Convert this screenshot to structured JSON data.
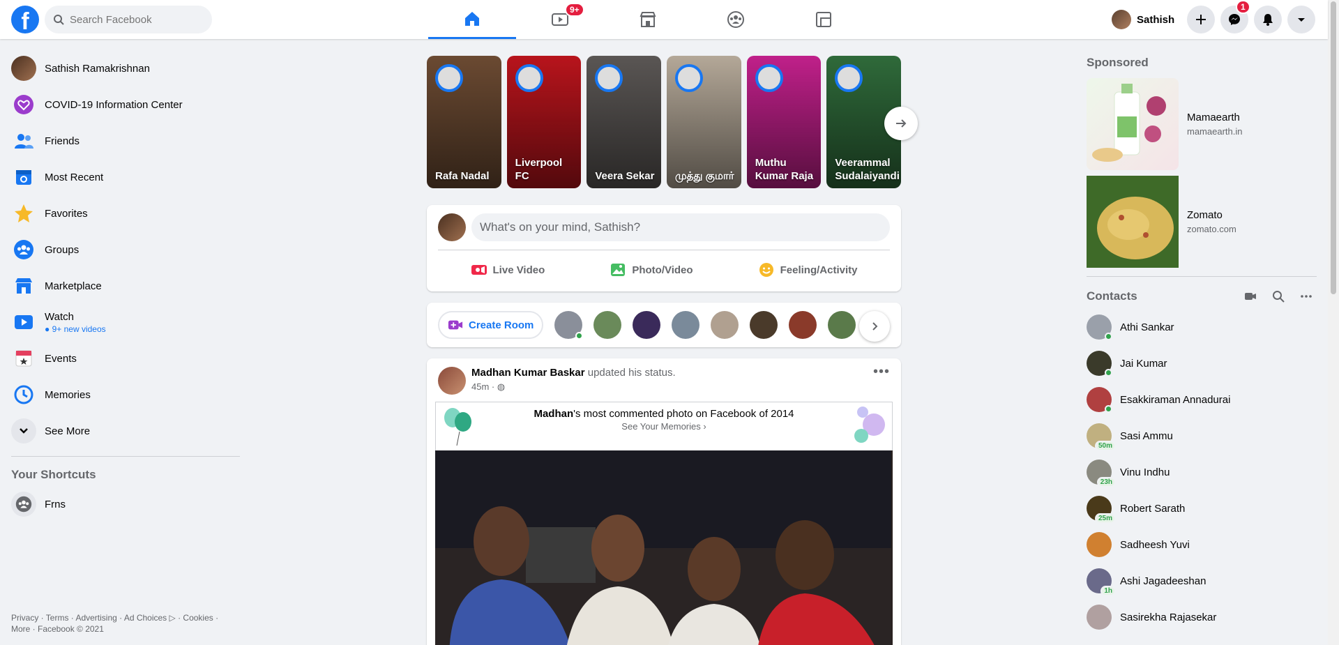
{
  "header": {
    "logo": "f",
    "search_placeholder": "Search Facebook",
    "watch_badge": "9+",
    "profile_name": "Sathish",
    "messenger_badge": "1"
  },
  "sidebar": {
    "items": [
      {
        "label": "Sathish Ramakrishnan",
        "icon": "avatar"
      },
      {
        "label": "COVID-19 Information Center",
        "icon": "heart-icon"
      },
      {
        "label": "Friends",
        "icon": "friends-icon"
      },
      {
        "label": "Most Recent",
        "icon": "calendar-icon"
      },
      {
        "label": "Favorites",
        "icon": "star-icon"
      },
      {
        "label": "Groups",
        "icon": "groups-icon"
      },
      {
        "label": "Marketplace",
        "icon": "store-icon"
      },
      {
        "label": "Watch",
        "sub": "9+ new videos",
        "icon": "watch-icon"
      },
      {
        "label": "Events",
        "icon": "events-icon"
      },
      {
        "label": "Memories",
        "icon": "clock-icon"
      },
      {
        "label": "See More",
        "icon": "chevron-down-icon"
      }
    ],
    "shortcuts_title": "Your Shortcuts",
    "shortcuts": [
      {
        "label": "Frns"
      }
    ],
    "footer_line1": "Privacy · Terms · Advertising · Ad Choices ▷ · Cookies ·",
    "footer_line2": "More · Facebook © 2021"
  },
  "stories": [
    {
      "name": "Rafa Nadal",
      "bg": "#6b4a32"
    },
    {
      "name": "Liverpool FC",
      "bg": "#b8141c"
    },
    {
      "name": "Veera Sekar",
      "bg": "#5a5654"
    },
    {
      "name": "முத்து குமார்",
      "bg": "#b4a898"
    },
    {
      "name": "Muthu Kumar Raja",
      "bg": "#c0208a"
    },
    {
      "name": "Veerammal Sudalaiyandi",
      "bg": "#2f6a3a"
    }
  ],
  "composer": {
    "placeholder": "What's on your mind, Sathish?",
    "live": "Live Video",
    "photo": "Photo/Video",
    "feeling": "Feeling/Activity"
  },
  "rooms": {
    "create": "Create Room",
    "avatar_colors": [
      "#8a8f9a",
      "#6a8a5a",
      "#3a2a5a",
      "#7a8a9a",
      "#b0a090",
      "#4a3a2a",
      "#8a3a2a",
      "#5a7a4a",
      "#6a5a3a"
    ]
  },
  "post": {
    "author": "Madhan Kumar Baskar",
    "action": "updated his status.",
    "time": "45m ·",
    "more": "•••",
    "memory_name": "Madhan",
    "memory_text": "'s most commented photo on Facebook of 2014",
    "memory_link": "See Your Memories ›"
  },
  "right": {
    "sponsored_title": "Sponsored",
    "ads": [
      {
        "name": "Mamaearth",
        "url": "mamaearth.in",
        "color": "#e9f5e6"
      },
      {
        "name": "Zomato",
        "url": "zomato.com",
        "color": "#4a6a30"
      }
    ],
    "contacts_title": "Contacts",
    "contacts": [
      {
        "name": "Athi Sankar",
        "status": "online",
        "color": "#9aa0aa"
      },
      {
        "name": "Jai Kumar",
        "status": "online",
        "color": "#3a3a2a"
      },
      {
        "name": "Esakkiraman Annadurai",
        "status": "online",
        "color": "#b04040"
      },
      {
        "name": "Sasi Ammu",
        "status": "50m",
        "color": "#c0b080"
      },
      {
        "name": "Vinu Indhu",
        "status": "23h",
        "color": "#8a8a80"
      },
      {
        "name": "Robert Sarath",
        "status": "25m",
        "color": "#4a3a1a"
      },
      {
        "name": "Sadheesh Yuvi",
        "status": "",
        "color": "#d08030"
      },
      {
        "name": "Ashi Jagadeeshan",
        "status": "1h",
        "color": "#6a6a8a"
      },
      {
        "name": "Sasirekha Rajasekar",
        "status": "",
        "color": "#b0a0a0"
      }
    ]
  }
}
